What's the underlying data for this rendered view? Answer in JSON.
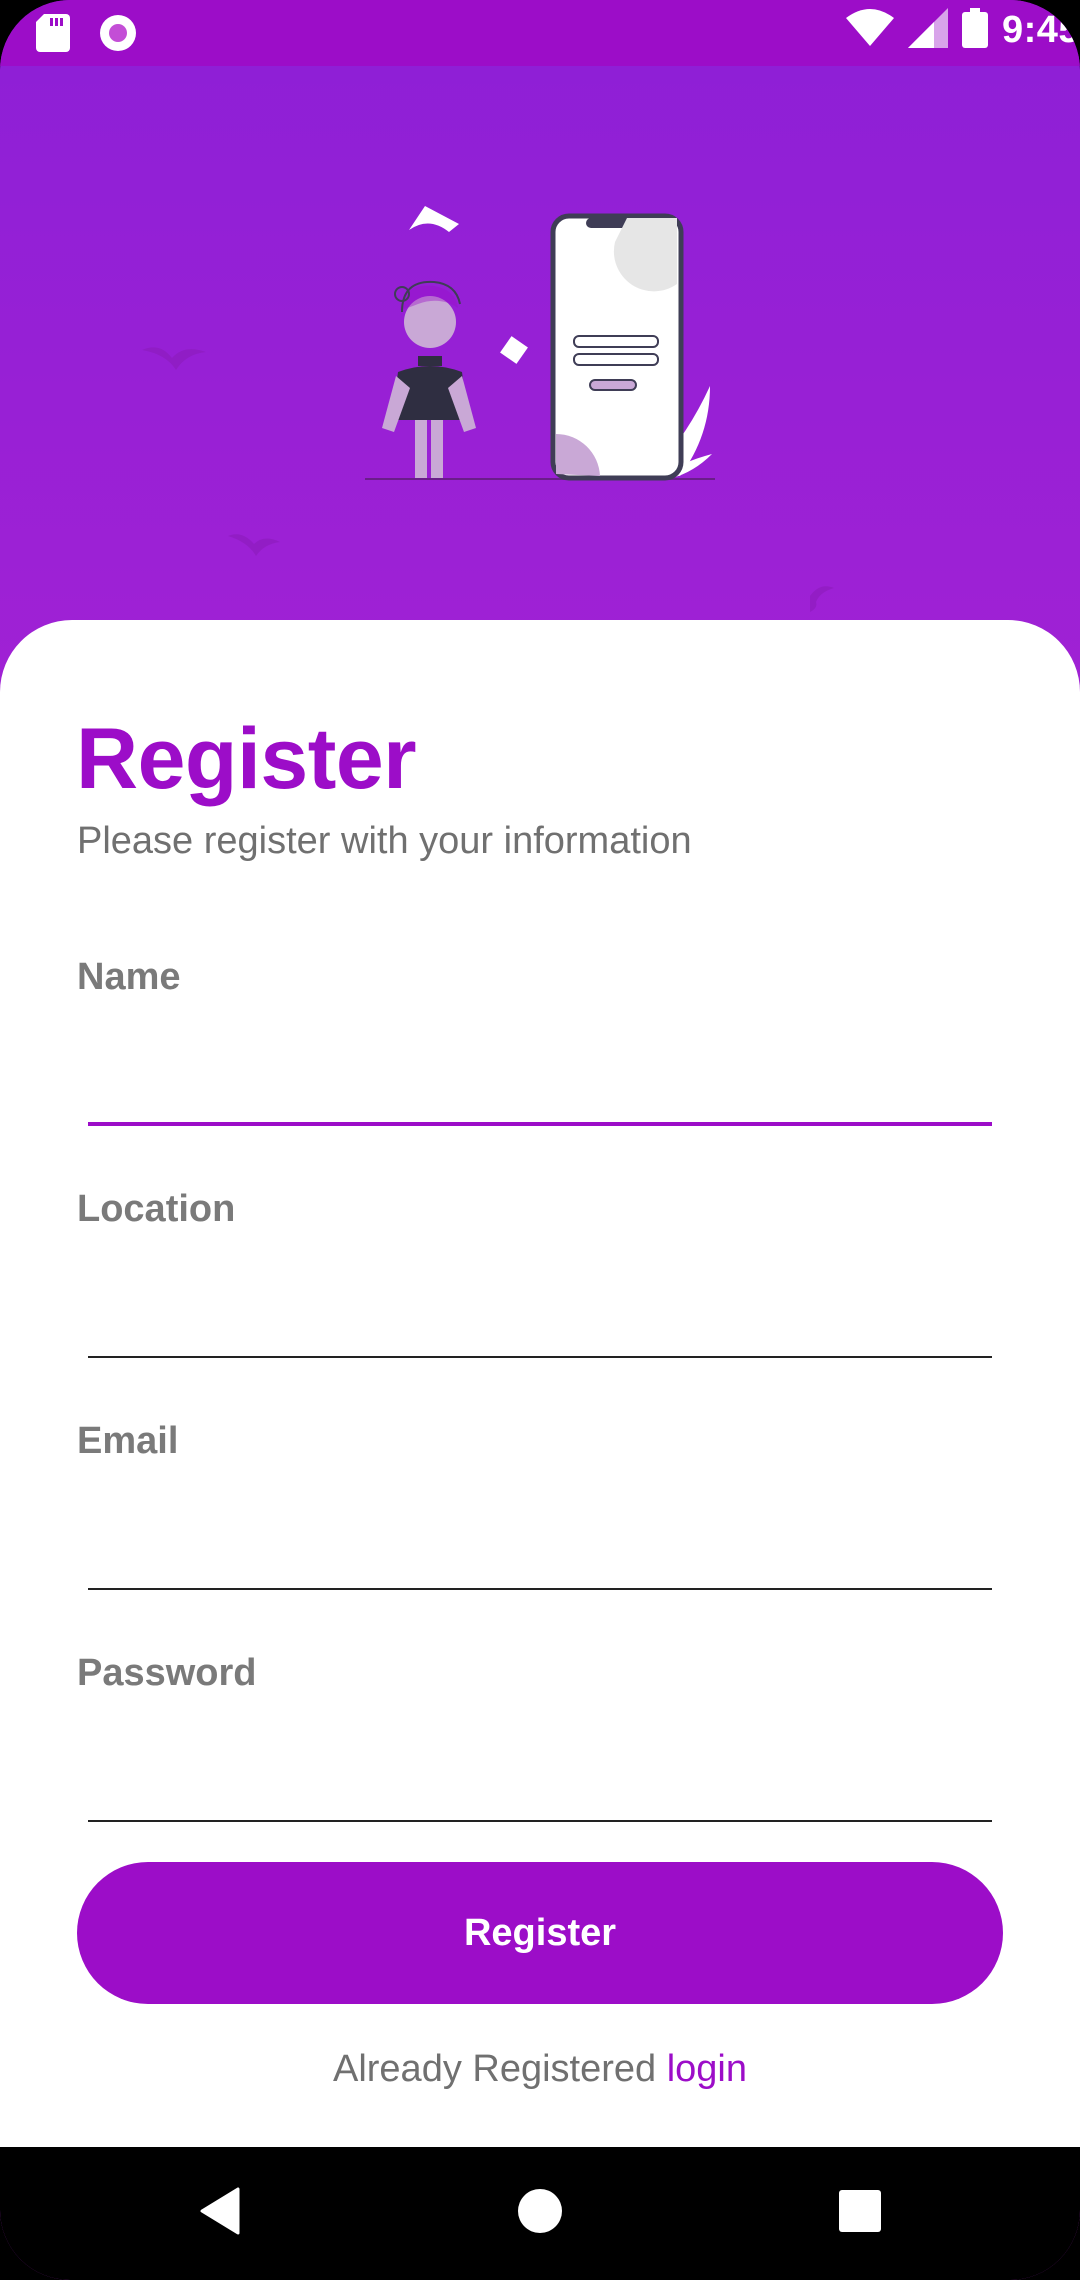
{
  "status_bar": {
    "time": "9:45",
    "left_icons": [
      "sd-card-icon",
      "record-icon"
    ],
    "right_icons": [
      "wifi-icon",
      "signal-icon",
      "battery-icon"
    ]
  },
  "register": {
    "title": "Register",
    "subtitle": "Please register with your information",
    "fields": [
      {
        "label": "Name",
        "value": "",
        "placeholder": "",
        "focused": true
      },
      {
        "label": "Location",
        "value": "",
        "placeholder": ""
      },
      {
        "label": "Email",
        "value": "",
        "placeholder": ""
      },
      {
        "label": "Password",
        "value": "",
        "placeholder": ""
      }
    ],
    "button_label": "Register",
    "already_text": "Already Registered",
    "login_link": "login"
  },
  "nav_bar": {
    "buttons": [
      "back-icon",
      "home-icon",
      "recents-icon"
    ]
  },
  "colors": {
    "accent": "#9c0dc8",
    "header_gradient_top": "#8d1fd6",
    "header_gradient_bottom": "#b224d3"
  }
}
